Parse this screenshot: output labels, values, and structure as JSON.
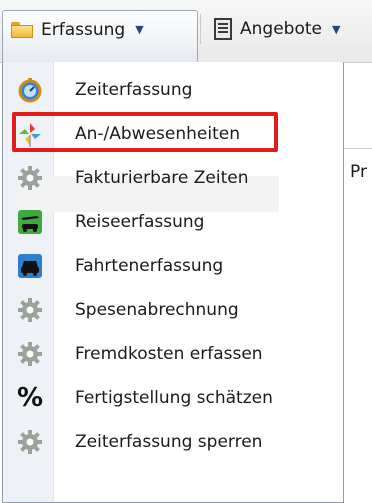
{
  "toolbar": {
    "erfassung_label": "Erfassung",
    "angebote_label": "Angebote",
    "caret": "▼"
  },
  "behind": {
    "partial_label": "Pr"
  },
  "menu": {
    "items": [
      {
        "label": "Zeiterfassung",
        "icon": "stopwatch-icon"
      },
      {
        "label": "An-/Abwesenheiten",
        "icon": "pinwheel-icon"
      },
      {
        "label": "Fakturierbare Zeiten",
        "icon": "gear-icon"
      },
      {
        "label": "Reiseerfassung",
        "icon": "travel-icon"
      },
      {
        "label": "Fahrtenerfassung",
        "icon": "car-icon"
      },
      {
        "label": "Spesenabrechnung",
        "icon": "gear-icon"
      },
      {
        "label": "Fremdkosten erfassen",
        "icon": "gear-icon"
      },
      {
        "label": "Fertigstellung schätzen",
        "icon": "percent-icon"
      },
      {
        "label": "Zeiterfassung sperren",
        "icon": "gear-icon"
      }
    ]
  },
  "colors": {
    "highlight": "#e21b1b",
    "menu_border": "#8f9cb0"
  }
}
